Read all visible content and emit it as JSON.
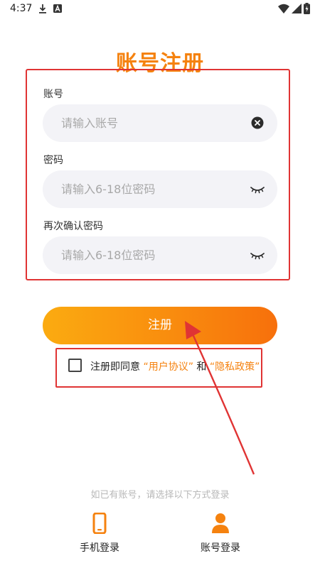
{
  "status_bar": {
    "time": "4:37"
  },
  "title": "账号注册",
  "form": {
    "account": {
      "label": "账号",
      "placeholder": "请输入账号"
    },
    "password": {
      "label": "密码",
      "placeholder": "请输入6-18位密码"
    },
    "confirm": {
      "label": "再次确认密码",
      "placeholder": "请输入6-18位密码"
    }
  },
  "register_button": "注册",
  "agreement": {
    "prefix": "注册即同意",
    "user_agreement": "“用户协议”",
    "conjunction": "和",
    "privacy_policy": "“隐私政策”",
    "checked": false
  },
  "alt_login": {
    "hint": "如已有账号，请选择以下方式登录",
    "phone_label": "手机登录",
    "account_label": "账号登录"
  },
  "colors": {
    "accent": "#f5820f",
    "annotation": "#e03434",
    "input_bg": "#f3f3f7",
    "button_start": "#fbab10",
    "button_end": "#f7700c"
  }
}
